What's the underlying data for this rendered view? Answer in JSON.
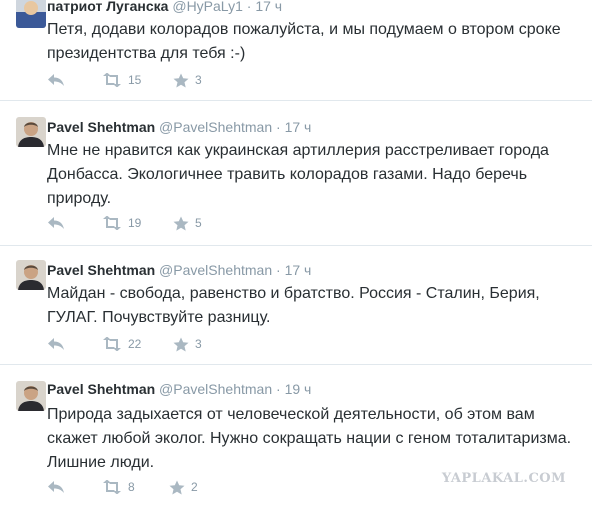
{
  "tweets": [
    {
      "name": "патриот Луганска",
      "handle": "@HyPaLy1",
      "dot": "·",
      "time": "17 ч",
      "text": "Петя,  додави колорадов пожалуйста, и мы подумаем о втором сроке президентства для тебя :-)",
      "retweets": "15",
      "favorites": "3"
    },
    {
      "name": "Pavel Shehtman",
      "handle": "@PavelShehtman",
      "dot": "·",
      "time": "17 ч",
      "text": "Мне не нравится как украинская артиллерия расстреливает города Донбасса. Экологичнее травить колорадов газами. Надо беречь природу.",
      "retweets": "19",
      "favorites": "5"
    },
    {
      "name": "Pavel Shehtman",
      "handle": "@PavelShehtman",
      "dot": "·",
      "time": "17 ч",
      "text": "Майдан - свобода, равенство и братство. Россия - Сталин, Берия, ГУЛАГ. Почувствуйте разницу.",
      "retweets": "22",
      "favorites": "3"
    },
    {
      "name": "Pavel Shehtman",
      "handle": "@PavelShehtman",
      "dot": "·",
      "time": "19 ч",
      "text": "Природа задыхается от человеческой деятельности, об этом вам скажет любой эколог. Нужно сокращать нации с геном тоталитаризма. Лишние люди.",
      "retweets": "8",
      "favorites": "2"
    }
  ],
  "watermark": "YAPLAKAL.COM",
  "colors": {
    "name": "#292f33",
    "meta": "#8899a6",
    "icon": "#aab8c2",
    "divider": "#e1e8ed"
  },
  "icons": {
    "reply": "reply-icon",
    "retweet": "retweet-icon",
    "favorite": "star-icon"
  }
}
